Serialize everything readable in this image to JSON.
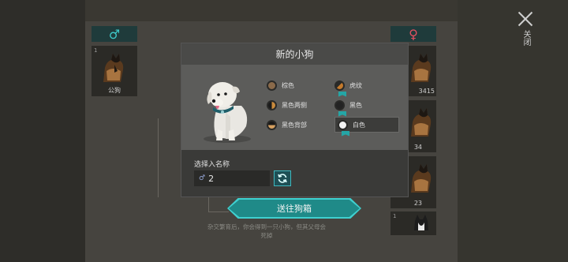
{
  "header": {
    "close_label": "关闭"
  },
  "parents": {
    "male_symbol": "♂",
    "female_symbol": "♀",
    "male_dogs": [
      {
        "index": "1",
        "name": "公狗"
      }
    ],
    "female_dogs": [
      {
        "index": "",
        "name": "3415"
      },
      {
        "index": "",
        "name": "34"
      },
      {
        "index": "",
        "name": "23"
      },
      {
        "index": "1",
        "name": ""
      }
    ]
  },
  "modal": {
    "title": "新的小狗",
    "color_options": [
      {
        "label": "棕色",
        "selected": false
      },
      {
        "label": "虎纹",
        "selected": false
      },
      {
        "label": "黑色两侧",
        "selected": false
      },
      {
        "label": "黑色",
        "selected": false
      },
      {
        "label": "黑色背部",
        "selected": false
      },
      {
        "label": "白色",
        "selected": true
      }
    ],
    "name_label": "选择入名称",
    "name_value": "2",
    "name_gender_symbol": "♂",
    "send_button": "送往狗箱",
    "hint": "杂交繁育后，你会得到一只小狗，但其父母会死掉"
  },
  "colors": {
    "accent": "#24a6a6",
    "male": "#3ec8c8",
    "female": "#e05060"
  }
}
